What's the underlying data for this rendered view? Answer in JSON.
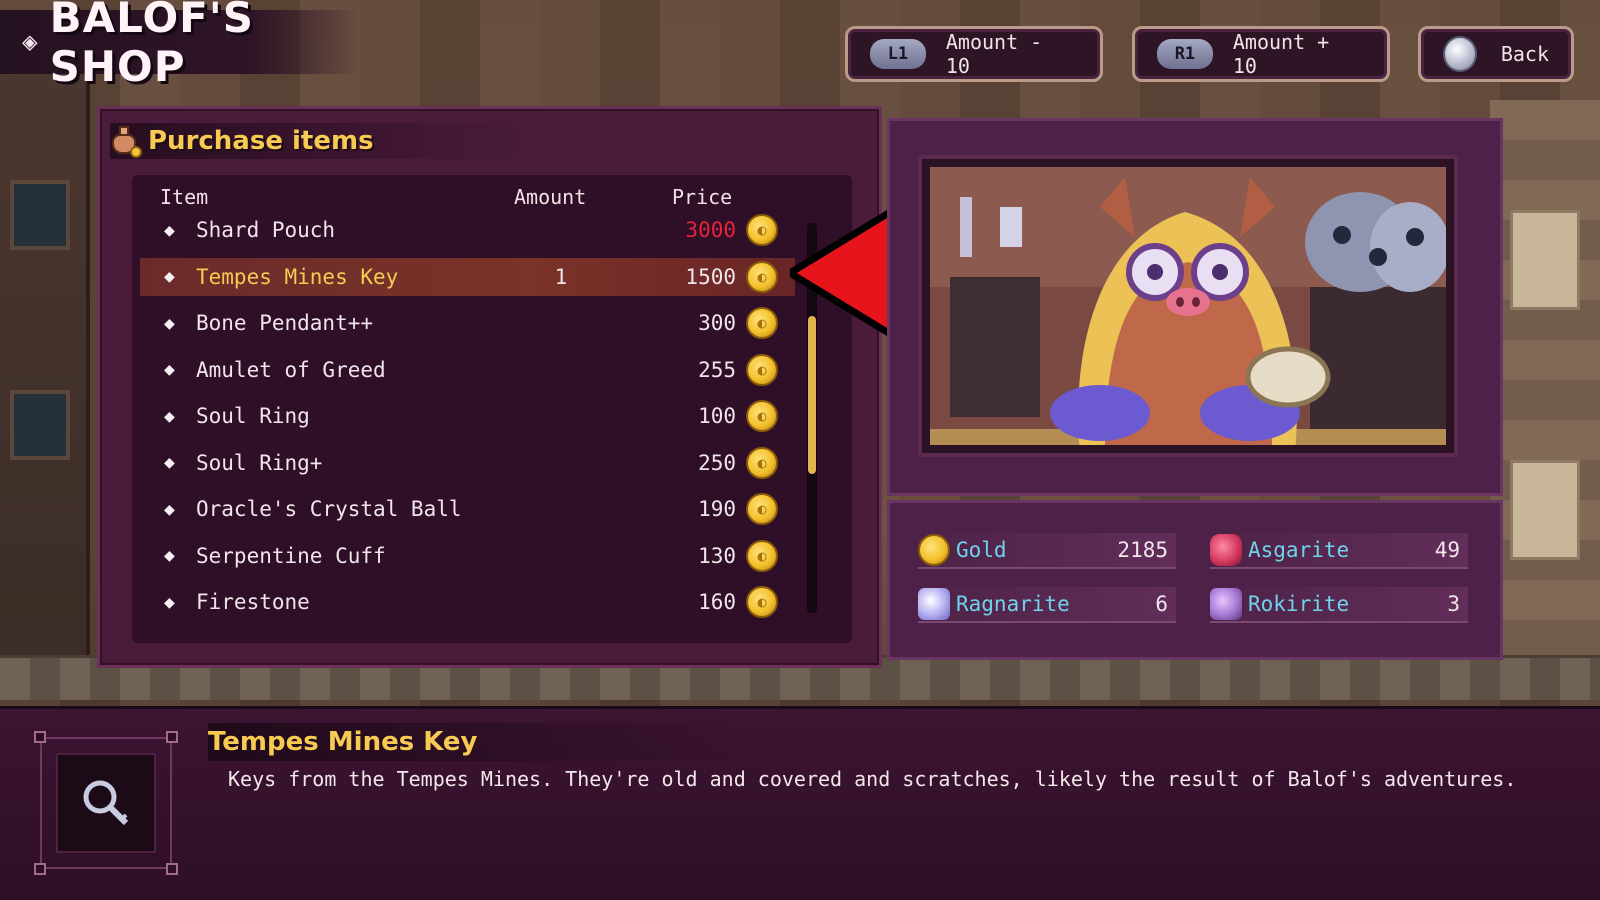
{
  "shop_title": "BALOF'S SHOP",
  "top_buttons": {
    "minus": {
      "key": "L1",
      "label": "Amount - 10"
    },
    "plus": {
      "key": "R1",
      "label": "Amount + 10"
    },
    "back": {
      "label": "Back"
    }
  },
  "purchase_panel": {
    "title": "Purchase items",
    "columns": {
      "item": "Item",
      "amount": "Amount",
      "price": "Price"
    },
    "items": [
      {
        "name": "Shard Pouch",
        "amount": "",
        "price": "3000",
        "affordable": false
      },
      {
        "name": "Tempes Mines Key",
        "amount": "1",
        "price": "1500",
        "affordable": true,
        "selected": true
      },
      {
        "name": "Bone Pendant++",
        "amount": "",
        "price": "300",
        "affordable": true
      },
      {
        "name": "Amulet of Greed",
        "amount": "",
        "price": "255",
        "affordable": true
      },
      {
        "name": "Soul Ring",
        "amount": "",
        "price": "100",
        "affordable": true
      },
      {
        "name": "Soul Ring+",
        "amount": "",
        "price": "250",
        "affordable": true
      },
      {
        "name": "Oracle's Crystal Ball",
        "amount": "",
        "price": "190",
        "affordable": true
      },
      {
        "name": "Serpentine Cuff",
        "amount": "",
        "price": "130",
        "affordable": true
      },
      {
        "name": "Firestone",
        "amount": "",
        "price": "160",
        "affordable": true
      }
    ],
    "scroll_position": 0.4
  },
  "currencies": {
    "gold": {
      "name": "Gold",
      "value": "2185"
    },
    "asgarite": {
      "name": "Asgarite",
      "value": "49"
    },
    "ragnarite": {
      "name": "Ragnarite",
      "value": "6"
    },
    "rokirite": {
      "name": "Rokirite",
      "value": "3"
    }
  },
  "description": {
    "title": "Tempes Mines Key",
    "text": "Keys from the Tempes Mines. They're old and covered and scratches, likely the result of Balof's adventures.",
    "icon": "key-icon"
  },
  "colors": {
    "accent_gold": "#f7cb52",
    "unaffordable_red": "#e5233a",
    "currency_cyan": "#6fd3ea",
    "arrow_red": "#e8141c"
  }
}
